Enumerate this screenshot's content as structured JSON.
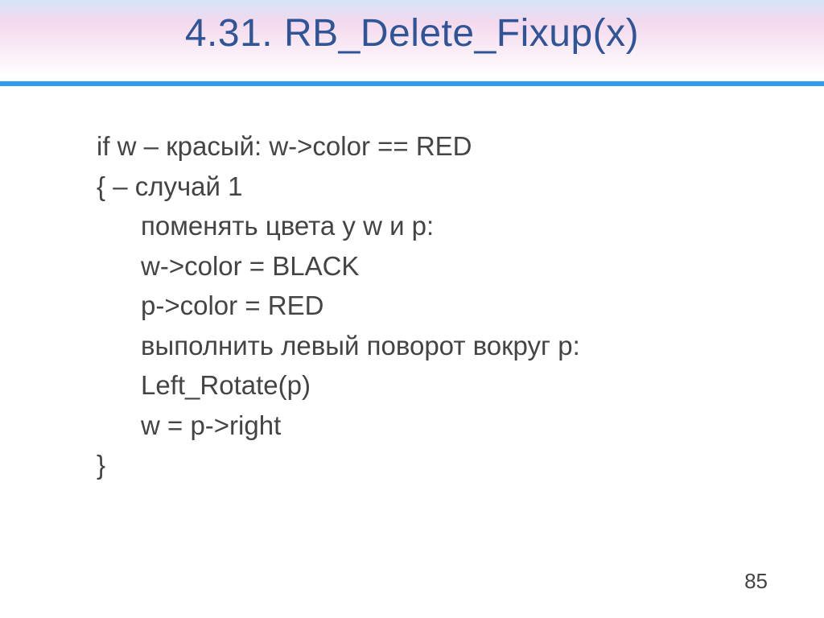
{
  "title": "4.31. RB_Delete_Fixup(x)",
  "lines": {
    "l1": "if w – красый: w->color == RED",
    "l2": "{ – случай 1",
    "l3": "поменять цвета у w и p:",
    "l4": "w->color = BLACK",
    "l5": "p->color = RED",
    "l6": "выполнить левый поворот вокруг p:",
    "l7": "Left_Rotate(p)",
    "l8": "w = p->right",
    "l9": "}"
  },
  "page_number": "85"
}
